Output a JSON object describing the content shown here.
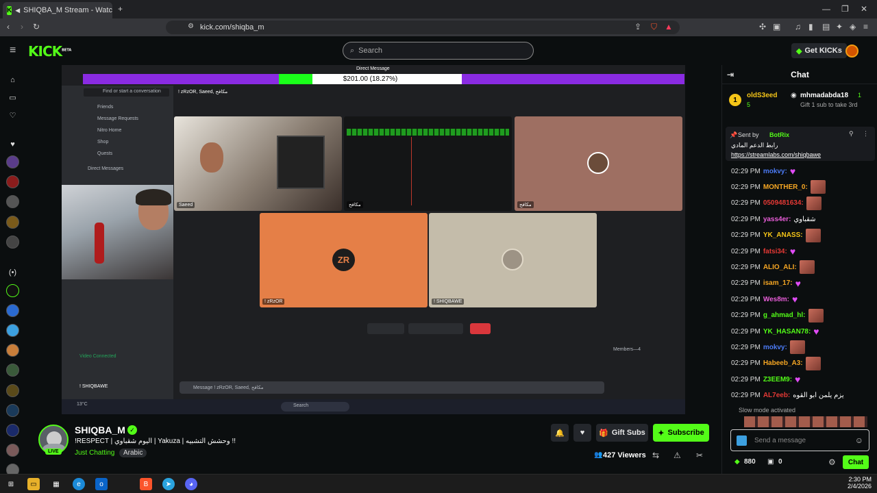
{
  "browser": {
    "tab_title": "SHIQBA_M Stream - Watch Li",
    "url": "kick.com/shiqba_m"
  },
  "header": {
    "logo": "KICK",
    "logo_badge": "BETA",
    "search_placeholder": "Search",
    "get_kicks": "Get KICKs"
  },
  "video": {
    "progress_text": "$201.00 (18.27%)",
    "progress_fraction": 0.1827,
    "dm_title": "Direct Message",
    "discord_search": "Find or start a conversation",
    "discord_menu": [
      "Friends",
      "Message Requests",
      "Nitro Home",
      "Shop",
      "Quests"
    ],
    "direct_messages_label": "Direct Messages",
    "group_name": "! zRzOR, Saeed, مكافح",
    "tiles": [
      {
        "name": "Saeed"
      },
      {
        "name": "مكافح"
      },
      {
        "name": "مكافح"
      },
      {
        "name": "! zRzOR"
      },
      {
        "name": "! SHIQBAWE"
      }
    ],
    "video_connected": "Video Connected",
    "self_name": "! SHIQBAWE",
    "message_placeholder": "Message ! zRzOR, Saeed, مكافح",
    "taskbar_search": "Search",
    "weather": "13°C",
    "members_label": "Members—4"
  },
  "streamer": {
    "name": "SHIQBA_M",
    "live": "LIVE",
    "title": "!RESPECT | اليوم شقباوي | Yakuza | وحشش التشبيه !!",
    "category": "Just Chatting",
    "tag": "Arabic",
    "viewers": "427 Viewers",
    "gift_subs": "Gift Subs",
    "subscribe": "Subscribe"
  },
  "chat": {
    "title": "Chat",
    "leader_rank": "1",
    "leader_user": "oldS3eed",
    "leader_count": "5",
    "leader_gifter": "mhmadabda18",
    "leader_gifter_count": "1",
    "leader_sub": "Gift 1 sub to take 3rd",
    "pinned_sender_label": "Sent by",
    "pinned_sender": "BotRix",
    "pinned_text": "رابط الدعم المادي",
    "pinned_link": "https://streamlabs.com/shiqbawe",
    "messages": [
      {
        "time": "02:29 PM",
        "user": "mokvy:",
        "color": "#4c7bf5",
        "text": "",
        "emote": "heart"
      },
      {
        "time": "02:29 PM",
        "user": "MONTHER_0:",
        "color": "#f5a623",
        "text": "",
        "emote": "face"
      },
      {
        "time": "02:29 PM",
        "user": "0509481634:",
        "color": "#e53935",
        "text": "",
        "emote": "face"
      },
      {
        "time": "02:29 PM",
        "user": "yass4er:",
        "color": "#e85dd8",
        "text": "شقباوي",
        "emote": ""
      },
      {
        "time": "02:29 PM",
        "user": "YK_ANASS:",
        "color": "#f5c518",
        "text": "",
        "emote": "face"
      },
      {
        "time": "02:29 PM",
        "user": "fatsi34:",
        "color": "#e53935",
        "text": "",
        "emote": "heart"
      },
      {
        "time": "02:29 PM",
        "user": "ALIO_ALI:",
        "color": "#f5a623",
        "text": "",
        "emote": "face"
      },
      {
        "time": "02:29 PM",
        "user": "isam_17:",
        "color": "#f5a623",
        "text": "",
        "emote": "heart"
      },
      {
        "time": "02:29 PM",
        "user": "Wes8m:",
        "color": "#e85dd8",
        "text": "",
        "emote": "heart"
      },
      {
        "time": "02:29 PM",
        "user": "g_ahmad_hl:",
        "color": "#53fc18",
        "text": "",
        "emote": "face"
      },
      {
        "time": "02:29 PM",
        "user": "YK_HASAN78:",
        "color": "#53fc18",
        "text": "",
        "emote": "heart"
      },
      {
        "time": "02:29 PM",
        "user": "mokvy:",
        "color": "#4c7bf5",
        "text": "",
        "emote": "face"
      },
      {
        "time": "02:29 PM",
        "user": "Habeeb_A3:",
        "color": "#f5a623",
        "text": "",
        "emote": "face"
      },
      {
        "time": "02:29 PM",
        "user": "Z3EEM9:",
        "color": "#53fc18",
        "text": "",
        "emote": "heart"
      },
      {
        "time": "02:29 PM",
        "user": "AL7eeb:",
        "color": "#e53935",
        "text": "يزم يلمن ابو القوه",
        "emote": ""
      }
    ],
    "slow_mode": "Slow mode activated",
    "input_placeholder": "Send a message",
    "kicks_count": "880",
    "gifts_count": "0",
    "send": "Chat"
  },
  "taskbar": {
    "time": "2:30 PM",
    "date": "2/4/2026"
  }
}
